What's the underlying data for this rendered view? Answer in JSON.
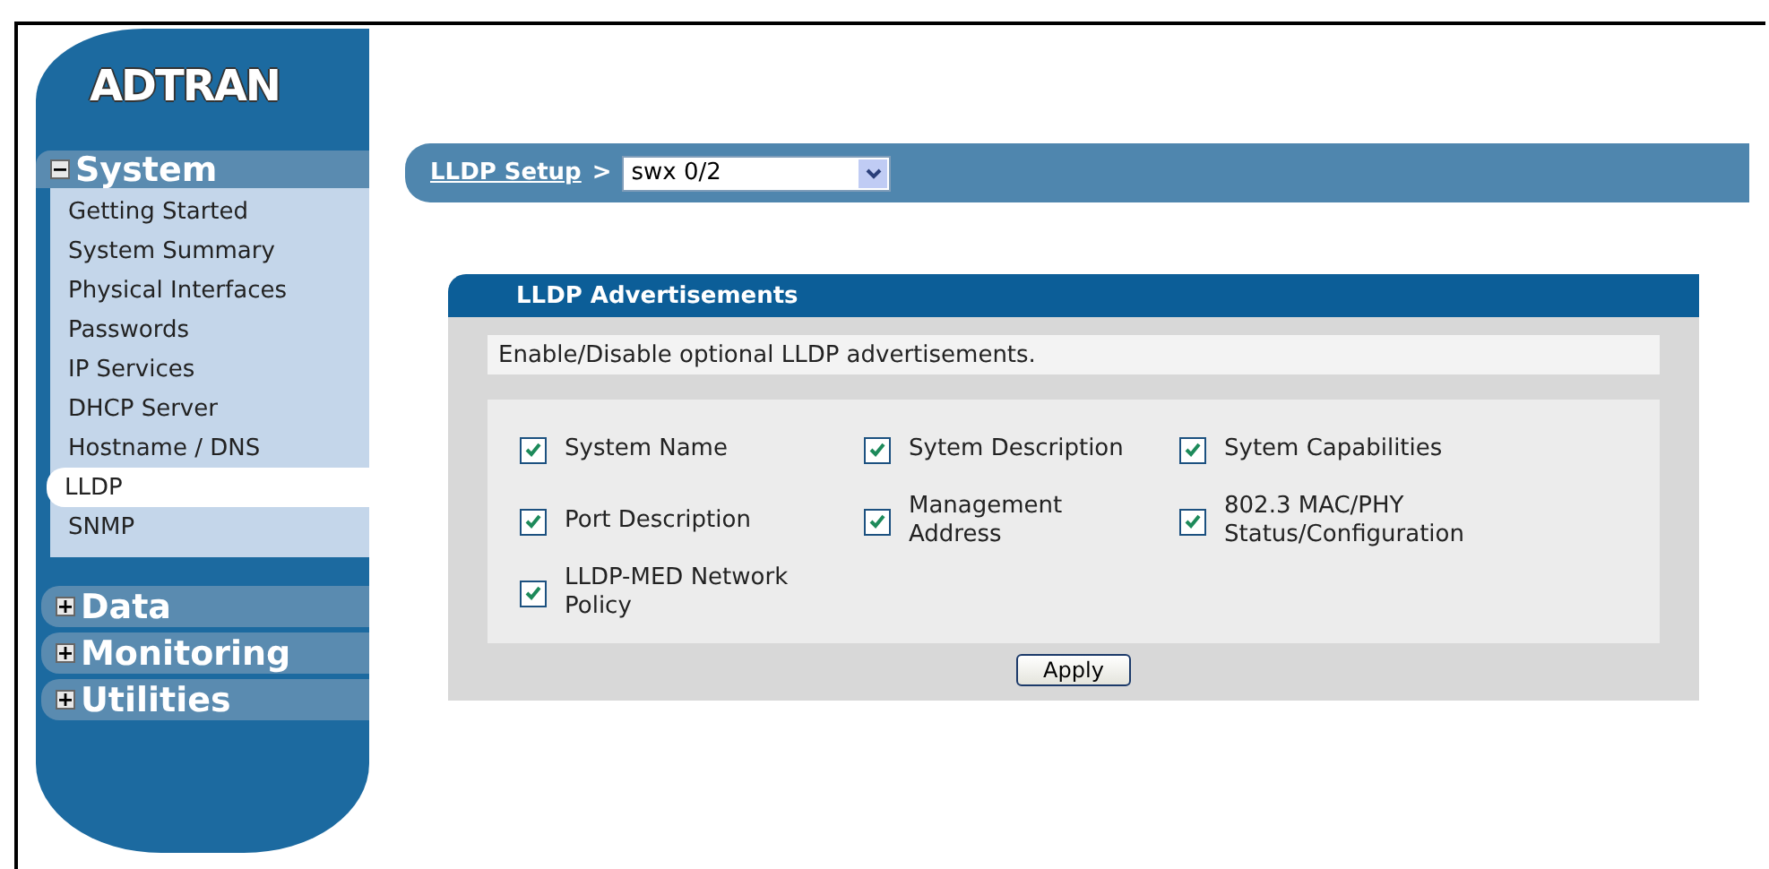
{
  "logo": "ADTRAN",
  "sidebar": {
    "sections": [
      {
        "title": "System",
        "expanded": true,
        "items": [
          {
            "label": "Getting Started",
            "selected": false
          },
          {
            "label": "System Summary",
            "selected": false
          },
          {
            "label": "Physical Interfaces",
            "selected": false
          },
          {
            "label": "Passwords",
            "selected": false
          },
          {
            "label": "IP Services",
            "selected": false
          },
          {
            "label": "DHCP Server",
            "selected": false
          },
          {
            "label": "Hostname / DNS",
            "selected": false
          },
          {
            "label": "LLDP",
            "selected": true
          },
          {
            "label": "SNMP",
            "selected": false
          }
        ]
      },
      {
        "title": "Data",
        "expanded": false
      },
      {
        "title": "Monitoring",
        "expanded": false
      },
      {
        "title": "Utilities",
        "expanded": false
      }
    ]
  },
  "breadcrumb": {
    "link": "LLDP Setup",
    "separator": ">",
    "interface": "swx 0/2"
  },
  "panel": {
    "title": "LLDP Advertisements",
    "description": "Enable/Disable optional LLDP advertisements.",
    "options": [
      {
        "label": "System Name",
        "checked": true
      },
      {
        "label": "Sytem Description",
        "checked": true
      },
      {
        "label": "Sytem Capabilities",
        "checked": true
      },
      {
        "label": "Port Description",
        "checked": true
      },
      {
        "label": "Management Address",
        "checked": true
      },
      {
        "label": "802.3 MAC/PHY Status/Configuration",
        "checked": true
      },
      {
        "label": "LLDP-MED Network Policy",
        "checked": true
      }
    ],
    "button": "Apply"
  }
}
